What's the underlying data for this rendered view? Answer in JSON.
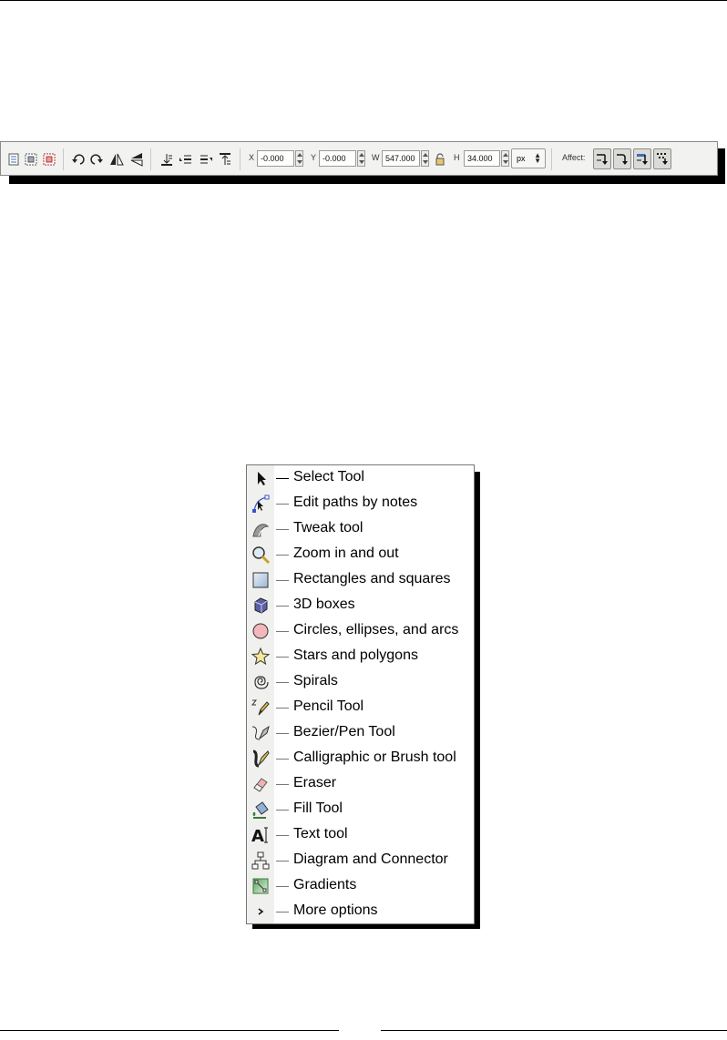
{
  "toolbar": {
    "x_label": "X",
    "x_value": "-0.000",
    "y_label": "Y",
    "y_value": "-0.000",
    "w_label": "W",
    "w_value": "547.000",
    "h_label": "H",
    "h_value": "34.000",
    "unit": "px",
    "affect_label": "Affect:",
    "icons": [
      "select-all-icon",
      "select-all-in-all-layers-icon",
      "deselect-icon",
      "rotate-ccw-icon",
      "rotate-cw-icon",
      "flip-horizontal-icon",
      "flip-vertical-icon",
      "lower-to-bottom-icon",
      "lower-icon",
      "raise-icon",
      "raise-to-top-icon",
      "lock-icon"
    ],
    "affect_buttons": [
      "scale-stroke-icon",
      "scale-corners-icon",
      "move-gradients-icon",
      "move-patterns-icon"
    ]
  },
  "tools": [
    {
      "label": "Select Tool",
      "icon": "arrow-pointer-icon"
    },
    {
      "label": "Edit paths by notes",
      "icon": "node-editor-icon"
    },
    {
      "label": "Tweak tool",
      "icon": "tweak-icon"
    },
    {
      "label": "Zoom in and out",
      "icon": "magnifier-icon"
    },
    {
      "label": "Rectangles and squares",
      "icon": "rectangle-icon"
    },
    {
      "label": "3D boxes",
      "icon": "3d-box-icon"
    },
    {
      "label": "Circles, ellipses, and arcs",
      "icon": "circle-icon"
    },
    {
      "label": "Stars and polygons",
      "icon": "star-icon"
    },
    {
      "label": "Spirals",
      "icon": "spiral-icon"
    },
    {
      "label": "Pencil Tool",
      "icon": "pencil-icon"
    },
    {
      "label": "Bezier/Pen Tool",
      "icon": "pen-icon"
    },
    {
      "label": "Calligraphic or Brush tool",
      "icon": "calligraphy-icon"
    },
    {
      "label": "Eraser",
      "icon": "eraser-icon"
    },
    {
      "label": "Fill Tool",
      "icon": "paint-bucket-icon"
    },
    {
      "label": "Text tool",
      "icon": "text-icon"
    },
    {
      "label": "Diagram and Connector",
      "icon": "connector-icon"
    },
    {
      "label": "Gradients",
      "icon": "gradient-icon"
    },
    {
      "label": "More options",
      "icon": "chevron-right-icon"
    }
  ],
  "colors": {
    "panel_strip": "#f0f0ee",
    "toolbar_bg": "#f2f2f0",
    "shadow": "#000000"
  }
}
